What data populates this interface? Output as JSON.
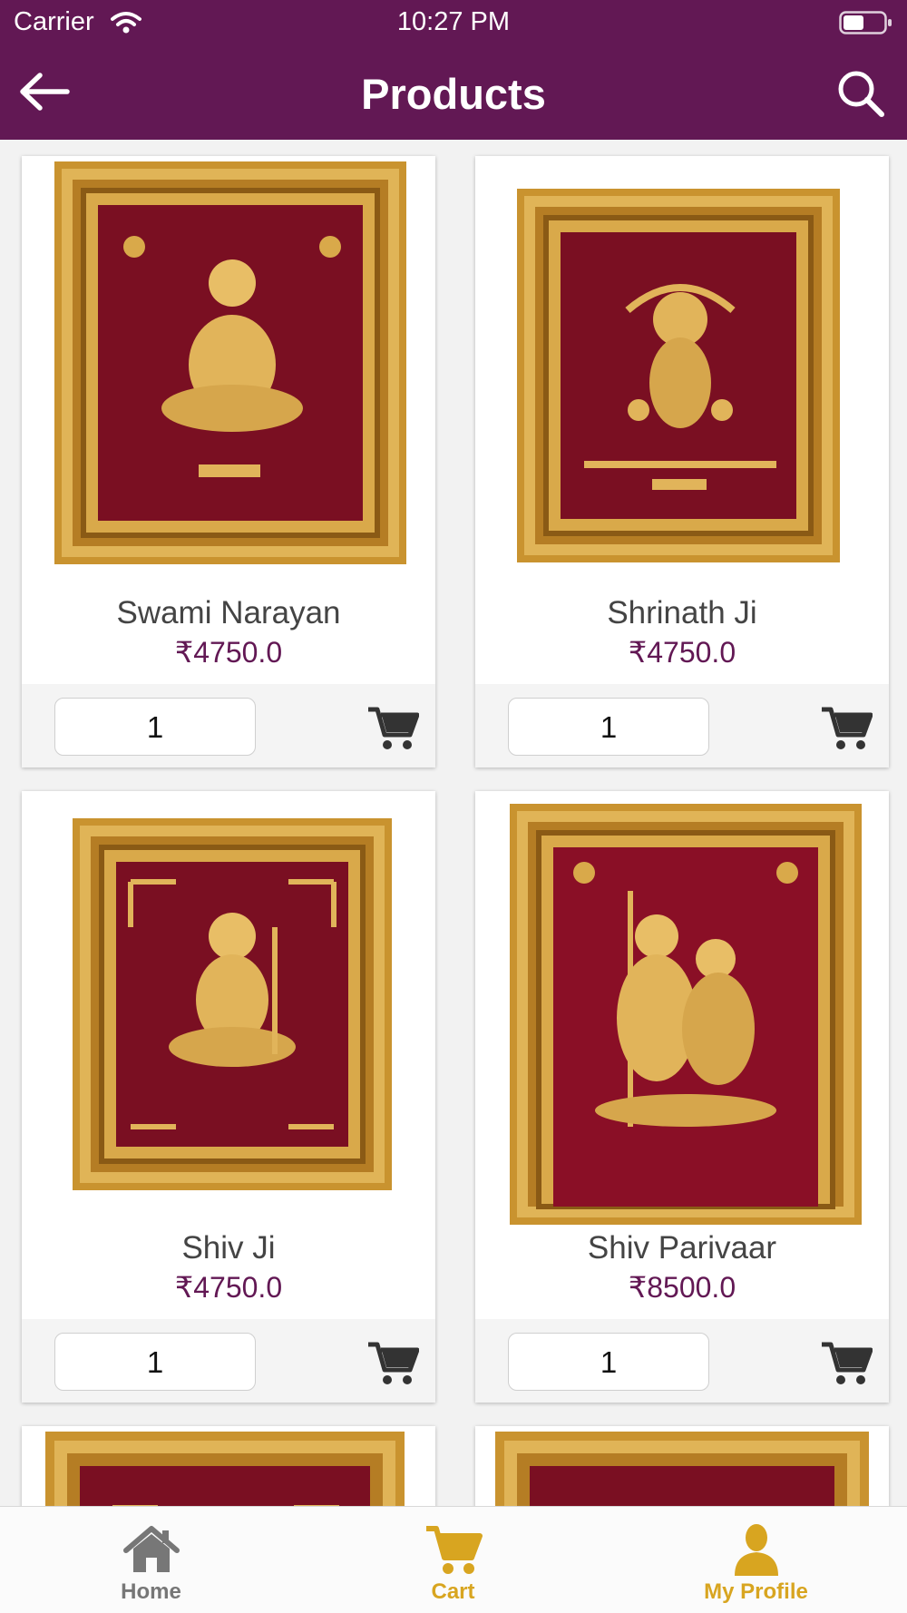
{
  "status_bar": {
    "carrier": "Carrier",
    "time": "10:27 PM"
  },
  "header": {
    "title": "Products"
  },
  "products": [
    {
      "name": "Swami Narayan",
      "price": "₹4750.0",
      "quantity": "1"
    },
    {
      "name": "Shrinath Ji",
      "price": "₹4750.0",
      "quantity": "1"
    },
    {
      "name": "Shiv Ji",
      "price": "₹4750.0",
      "quantity": "1"
    },
    {
      "name": "Shiv Parivaar",
      "price": "₹8500.0",
      "quantity": "1"
    }
  ],
  "tabs": [
    {
      "label": "Home",
      "icon": "home-icon",
      "color": "#777777"
    },
    {
      "label": "Cart",
      "icon": "cart-icon",
      "color": "#d8a520"
    },
    {
      "label": "My Profile",
      "icon": "profile-icon",
      "color": "#d8a520"
    }
  ],
  "colors": {
    "brand": "#621854",
    "accent": "#d8a520",
    "frame_gold": "#c9932f",
    "velvet": "#7a0f22"
  }
}
